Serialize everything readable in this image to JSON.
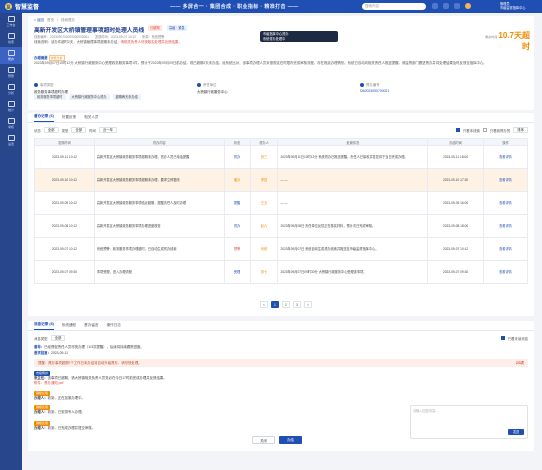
{
  "app": {
    "name": "智慧监督",
    "logo_text": "监",
    "slogan": "—— 多屏合一 · 集团合成 · 职业指标 · 精准打击 ——"
  },
  "topbar": {
    "search_placeholder": "搜索内容",
    "user_name": "管理员",
    "user_role": "市级监督指挥中心"
  },
  "sidebar": {
    "items": [
      {
        "label": "工作台",
        "active": false
      },
      {
        "label": "线索",
        "active": false
      },
      {
        "label": "督办",
        "active": true
      },
      {
        "label": "预警",
        "active": false
      },
      {
        "label": "分析",
        "active": false
      },
      {
        "label": "统计",
        "active": false
      },
      {
        "label": "考核",
        "active": false
      },
      {
        "label": "设置",
        "active": false
      }
    ]
  },
  "breadcrumb": {
    "back": "< 返回",
    "home": "首页",
    "sep": "/",
    "current": "线索督办"
  },
  "case": {
    "title": "高新开发区大桥镇管理事项超时处理人员线",
    "tags": [
      {
        "text": "已超期",
        "color": "#e34a3a",
        "bg": "#fde8e6"
      },
      {
        "text": "高级 · 紧急",
        "color": "#1f4fb2",
        "bg": "#e8eefb"
      }
    ],
    "meta": [
      "线索编号：2023090700000000000001",
      "发现时间：2023-09-07 10:12",
      "来源：系统预警"
    ],
    "status_pill_line1": "市级指挥中心督办",
    "status_pill_line2": "系统督办处理中",
    "timer_label": "剩余时间",
    "timer_value": "10.7天超时",
    "reason_lead": "线索说明：",
    "reason_text": "该办件超时2天，大桥镇管理事项超期未办结，",
    "reason_hl": "请相关负责人尽快核实处理并反馈结果。",
    "summary_label": "办理摘要",
    "summary_badge": "智能分析",
    "summary_text": "2023年09月07日10时12分 大桥镇行政服务中心受理政务服务事项1件，预计于2023年09月09日前办结，现已超期2天未办结，经系统比对，该事项办理人员未按规定在时限内完成审核流程，存在拖延办理情形。系统已自动向相关责任人推送提醒，请监督部门跟进督办并将处理结果及时反馈至指挥中心。",
    "info": [
      {
        "label": "事项类型",
        "value": "政务服务事项超时办理"
      },
      {
        "label": "责任单位",
        "value": "大桥镇行政服务中心"
      },
      {
        "label": "督办编号",
        "value": "DB2023090700021"
      }
    ],
    "chips": [
      "政务服务事项超时",
      "大桥镇行政服务中心督办",
      "超期两天未办结"
    ]
  },
  "list": {
    "tabs": [
      {
        "label": "督办记录 (6)",
        "active": true
      },
      {
        "label": "处置反馈",
        "active": false
      },
      {
        "label": "相关人员",
        "active": false
      }
    ],
    "filters": [
      {
        "label": "状态",
        "value": "全部"
      },
      {
        "label": "类型",
        "value": "全部"
      },
      {
        "label": "时间",
        "value": "近一年"
      }
    ],
    "filter_check": "只看本线索",
    "filter_check2": "只看我督办的",
    "filter_sort": "排序",
    "headers": [
      "发现时间",
      "督办内容",
      "状态",
      "督办人",
      "处置情况",
      "办结时间",
      "操作"
    ],
    "rows": [
      {
        "time": "2023-09-11\n10:12",
        "content": "高新开发区大桥镇政务服务事项超期未办理，督办人员已电话提醒",
        "status": "督办",
        "person": "张三",
        "detail": "2023年09月11日10时12分 系统督办已推送提醒，责任人已接收并答复将于当日完成办理。",
        "end": "2023-09-11\n18:00",
        "op": "查看详情",
        "hl": false
      },
      {
        "time": "2023-09-10\n10:12",
        "content": "高新开发区大桥镇政务服务事项超期未办理，要求立即整改",
        "status": "催办",
        "person": "李四",
        "detail": "— —",
        "end": "2023-09-10\n17:30",
        "op": "查看详情",
        "hl": true
      },
      {
        "time": "2023-09-09\n10:12",
        "content": "高新开发区大桥镇政务服务事项临近超期，提醒责任人及时办理",
        "status": "提醒",
        "person": "王五",
        "detail": "— —",
        "end": "2023-09-09\n16:00",
        "op": "查看详情",
        "hl": false
      },
      {
        "time": "2023-09-08\n10:12",
        "content": "高新开发区大桥镇政务服务事项办理进度核查",
        "status": "督办",
        "person": "赵六",
        "detail": "2023年09月08日 责任单位反馈正在核实材料，预计次日完成审核。",
        "end": "2023-09-08\n18:00",
        "op": "查看详情",
        "hl": false
      },
      {
        "time": "2023-09-07\n10:12",
        "content": "系统预警：政务服务事项办理超时，已自动生成督办线索",
        "status": "预警",
        "person": "系统",
        "detail": "2023年09月07日 系统自动生成督办线索并推送至市级监督指挥中心。",
        "end": "2023-09-07\n10:12",
        "op": "查看详情",
        "hl": false
      },
      {
        "time": "2023-09-07\n09:30",
        "content": "事项受理，进入办理流程",
        "status": "受理",
        "person": "钱七",
        "detail": "2023年09月07日09时30分 大桥镇行政服务中心受理该事项。",
        "end": "2023-09-07\n09:30",
        "op": "查看详情",
        "hl": false
      }
    ],
    "pager": [
      "<",
      "1",
      "2",
      "3",
      ">"
    ]
  },
  "messages": {
    "tabs": [
      {
        "label": "消息记录 (8)",
        "active": true
      },
      {
        "label": "系统通知",
        "active": false
      },
      {
        "label": "督办留言",
        "active": false
      },
      {
        "label": "操作日志",
        "active": false
      }
    ],
    "filter_label": "消息类型",
    "filter_value": "全部",
    "filter_check": "只看未读消息",
    "items": [
      {
        "label": "",
        "who": "督导：",
        "text": "已经督促责任人员尽快办理（1/3次提醒），后续将持续跟踪进度。",
        "time": ""
      },
      {
        "label": "",
        "who": "要求回复：",
        "text": "2023-09-11",
        "time": ""
      }
    ],
    "warning_text": "提醒：督办事项超期7个工作日未办结将自动升级督办，请尽快处理。",
    "warning_num": "2/3次",
    "blocks": [
      {
        "tag": "市级督办",
        "tag_color": "#1f4fb2",
        "who": "张主任：",
        "text": "该事项已超期，请大桥镇相关负责人员务必在今日17时前完成办理并反馈结果。",
        "link": "附件：督办通知.pdf"
      },
      {
        "tag": "镇级反馈",
        "tag_color": "#f08a00",
        "who": "办理人：",
        "text": "收到，正在加紧办理中。",
        "link": ""
      },
      {
        "tag": "镇级反馈",
        "tag_color": "#f08a00",
        "who": "办理人：",
        "text": "收到，已安排专人办理。",
        "link": ""
      },
      {
        "tag": "镇级反馈",
        "tag_color": "#f08a00",
        "who": "办理人：",
        "text": "收到，已完成办理并提交审核。",
        "link": ""
      }
    ],
    "reply_placeholder": "请输入回复内容…",
    "reply_send": "发送"
  },
  "bottom": {
    "cancel": "关闭",
    "confirm": "办结"
  }
}
